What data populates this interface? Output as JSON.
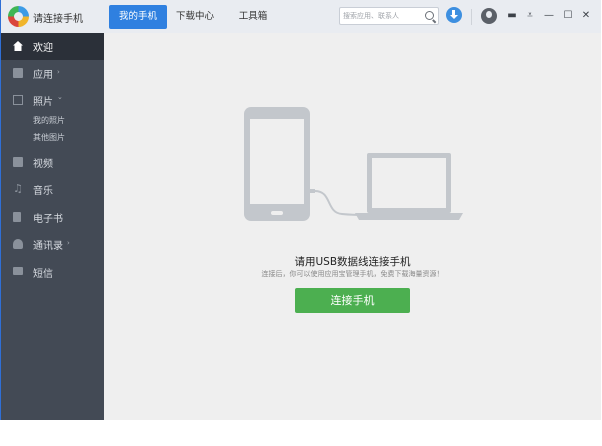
{
  "app": {
    "title": "请连接手机"
  },
  "tabs": [
    {
      "label": "我的手机",
      "active": true
    },
    {
      "label": "下载中心",
      "active": false
    },
    {
      "label": "工具箱",
      "active": false
    }
  ],
  "search": {
    "placeholder": "搜索应用、联系人"
  },
  "icons": {
    "logo": "app-logo-icon",
    "search": "search-icon",
    "download": "download-icon",
    "user": "user-icon",
    "menu": "menu-icon",
    "dropdown": "dropdown-icon",
    "minimize": "minimize-icon",
    "maximize": "maximize-icon",
    "close": "close-icon"
  },
  "sidebar": {
    "items": [
      {
        "label": "欢迎",
        "icon": "home-icon",
        "active": true
      },
      {
        "label": "应用",
        "icon": "app-icon",
        "arrow": "›"
      },
      {
        "label": "照片",
        "icon": "photo-icon",
        "arrow": "⌄"
      },
      {
        "label": "视频",
        "icon": "video-icon"
      },
      {
        "label": "音乐",
        "icon": "music-icon"
      },
      {
        "label": "电子书",
        "icon": "book-icon"
      },
      {
        "label": "通讯录",
        "icon": "contact-icon",
        "arrow": "›"
      },
      {
        "label": "短信",
        "icon": "sms-icon"
      }
    ],
    "photo_sub": [
      "我的照片",
      "其他图片"
    ]
  },
  "main": {
    "title": "请用USB数据线连接手机",
    "description": "连接后，你可以使用应用宝管理手机，免费下载海量资源！",
    "button": "连接手机"
  },
  "colors": {
    "accent": "#2f80e0",
    "sidebar_bg": "#434a55",
    "sidebar_active": "#2b3039",
    "button_green": "#4caf50",
    "illustration": "#c3c7cc"
  }
}
